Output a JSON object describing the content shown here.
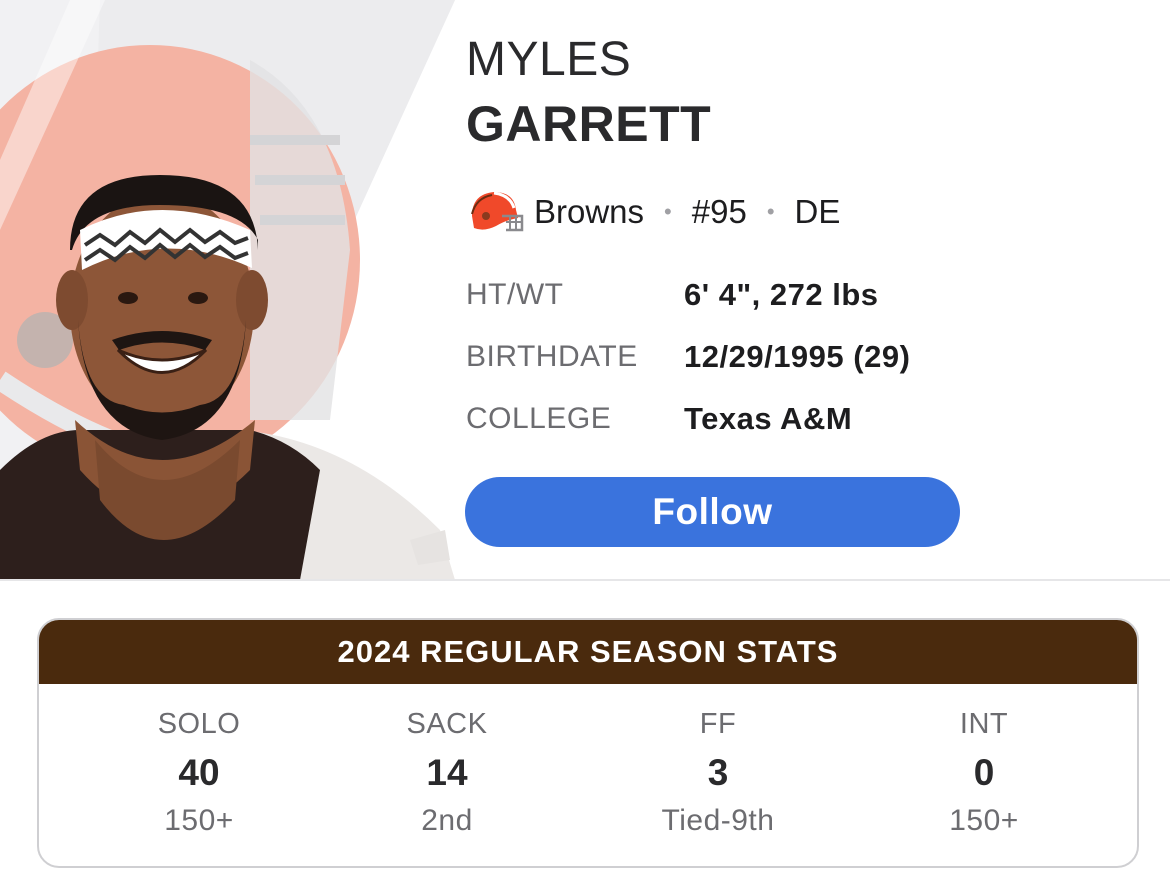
{
  "player": {
    "first_name": "MYLES",
    "last_name": "GARRETT",
    "team": "Browns",
    "number": "#95",
    "position": "DE",
    "team_logo_icon": "browns-helmet-icon"
  },
  "info": [
    {
      "label": "HT/WT",
      "value": "6' 4\", 272 lbs"
    },
    {
      "label": "BIRTHDATE",
      "value": "12/29/1995 (29)"
    },
    {
      "label": "COLLEGE",
      "value": "Texas A&M"
    }
  ],
  "follow_label": "Follow",
  "stats": {
    "title": "2024 REGULAR SEASON STATS",
    "items": [
      {
        "label": "SOLO",
        "value": "40",
        "rank": "150+"
      },
      {
        "label": "SACK",
        "value": "14",
        "rank": "2nd"
      },
      {
        "label": "FF",
        "value": "3",
        "rank": "Tied-9th"
      },
      {
        "label": "INT",
        "value": "0",
        "rank": "150+"
      }
    ]
  },
  "colors": {
    "accent_blue": "#3a73dd",
    "browns_brown": "#4a2a0d",
    "browns_orange": "#f0492a"
  }
}
